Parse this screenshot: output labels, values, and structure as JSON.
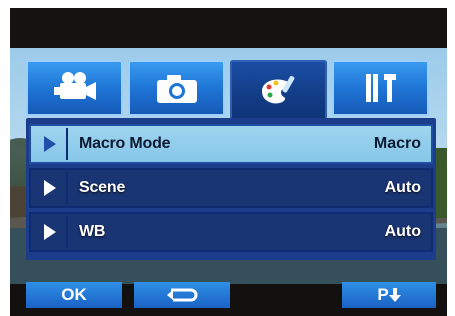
{
  "tabs": [
    {
      "icon": "movie-camera-icon",
      "selected": false
    },
    {
      "icon": "photo-camera-icon",
      "selected": false
    },
    {
      "icon": "palette-brush-icon",
      "selected": true
    },
    {
      "icon": "tools-settings-icon",
      "selected": false
    }
  ],
  "menu": {
    "items": [
      {
        "label": "Macro Mode",
        "value": "Macro",
        "selected": true
      },
      {
        "label": "Scene",
        "value": "Auto",
        "selected": false
      },
      {
        "label": "WB",
        "value": "Auto",
        "selected": false
      }
    ]
  },
  "buttons": {
    "ok_label": "OK",
    "back_icon": "return-arrow-icon",
    "page_label": "P"
  },
  "colors": {
    "tab_blue": "#1f75d6",
    "tab_selected": "#123c86",
    "row_selected": "#9ed4ef",
    "menu_frame": "#1b3d8c"
  }
}
